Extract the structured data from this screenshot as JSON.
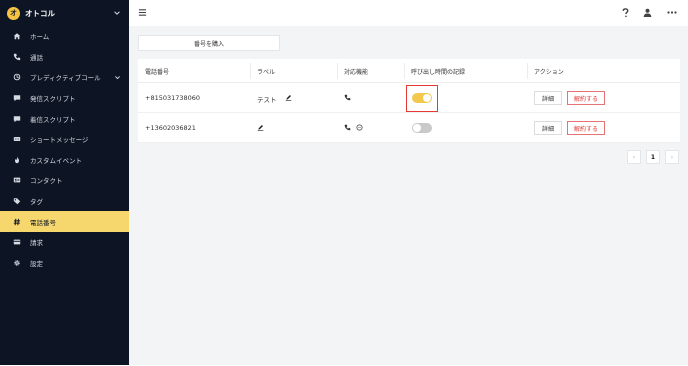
{
  "brand": {
    "name": "オトコル",
    "logo_text": "オ"
  },
  "sidebar": {
    "items": [
      {
        "label": "ホーム",
        "icon": "home-icon"
      },
      {
        "label": "通話",
        "icon": "phone-icon"
      },
      {
        "label": "プレディクティブコール",
        "icon": "predictive-icon",
        "has_chevron": true
      },
      {
        "label": "発信スクリプト",
        "icon": "chat-icon"
      },
      {
        "label": "着信スクリプト",
        "icon": "chat-icon"
      },
      {
        "label": "ショートメッセージ",
        "icon": "sms-icon"
      },
      {
        "label": "カスタムイベント",
        "icon": "flame-icon"
      },
      {
        "label": "コンタクト",
        "icon": "contact-card-icon"
      },
      {
        "label": "タグ",
        "icon": "tag-icon"
      },
      {
        "label": "電話番号",
        "icon": "hash-icon",
        "active": true
      },
      {
        "label": "請求",
        "icon": "credit-card-icon"
      },
      {
        "label": "設定",
        "icon": "gear-icon"
      }
    ]
  },
  "main": {
    "buy_button": "番号を購入",
    "table": {
      "headers": [
        "電話番号",
        "ラベル",
        "対応機能",
        "呼び出し時間の記録",
        "アクション"
      ],
      "rows": [
        {
          "number": "+815031738060",
          "label": "テスト",
          "recording_on": true
        },
        {
          "number": "+13602036821",
          "label": "",
          "recording_on": false
        }
      ],
      "detail_label": "詳細",
      "cancel_label": "解約する"
    },
    "pagination": {
      "current_page": "1",
      "prev": "‹",
      "next": "›"
    }
  },
  "colors": {
    "sidebar_bg": "#0d1524",
    "active": "#f5d76e",
    "toggle_on": "#f2c94c",
    "danger": "#e53935"
  }
}
